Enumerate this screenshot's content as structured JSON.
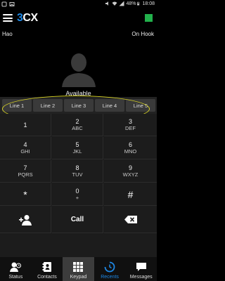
{
  "statusbar": {
    "battery_percent": "48%",
    "time": "18:08"
  },
  "app": {
    "logo_num": "3",
    "logo_text": "CX",
    "account_name": "Hao",
    "hook_status": "On Hook",
    "availability": "Available",
    "accent_color": "#1e88e5",
    "status_color": "#22b14c"
  },
  "lines": [
    "Line 1",
    "Line 2",
    "Line 3",
    "Line 4",
    "Line 5"
  ],
  "keypad": {
    "keys": [
      {
        "digit": "1",
        "letters": ""
      },
      {
        "digit": "2",
        "letters": "ABC"
      },
      {
        "digit": "3",
        "letters": "DEF"
      },
      {
        "digit": "4",
        "letters": "GHI"
      },
      {
        "digit": "5",
        "letters": "JKL"
      },
      {
        "digit": "6",
        "letters": "MNO"
      },
      {
        "digit": "7",
        "letters": "PQRS"
      },
      {
        "digit": "8",
        "letters": "TUV"
      },
      {
        "digit": "9",
        "letters": "WXYZ"
      },
      {
        "digit": "*",
        "letters": ""
      },
      {
        "digit": "0",
        "letters": "+"
      },
      {
        "digit": "#",
        "letters": ""
      }
    ],
    "call_label": "Call"
  },
  "nav": [
    {
      "label": "Status",
      "icon": "status-icon"
    },
    {
      "label": "Contacts",
      "icon": "contacts-icon"
    },
    {
      "label": "Keypad",
      "icon": "keypad-grid-icon"
    },
    {
      "label": "Recents",
      "icon": "recents-clock-icon"
    },
    {
      "label": "Messages",
      "icon": "messages-bubble-icon"
    }
  ]
}
